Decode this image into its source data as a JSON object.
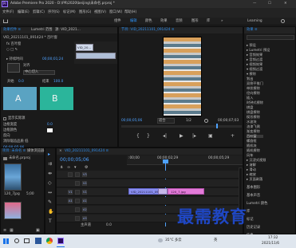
{
  "window": {
    "title": "Adobe Premiere Pro 2020 - D:\\PR\\2020\\beijing\\未命名.prproj *",
    "controls": [
      "—",
      "☐",
      "✕"
    ]
  },
  "menu": [
    "文件(F)",
    "编辑(E)",
    "剪辑(C)",
    "序列(S)",
    "标记(M)",
    "图形(G)",
    "视图(V)",
    "窗口(W)",
    "帮助(H)"
  ],
  "workspaces": [
    "组件",
    "编辑",
    "颜色",
    "效果",
    "音频",
    "图形",
    "库",
    "»"
  ],
  "workspace_right": "Learning",
  "effect_controls": {
    "tabs": [
      "效果控件 ≡",
      "Lumetri 范围",
      "源: VID_2021..."
    ],
    "header": "VID_20211101_091424 * 百叶窗",
    "clip_label": "VID_20...",
    "fx": "fx 百叶窗",
    "items": [
      "○ □ ✎",
      "▸ 过渡持续时间 00;00;01;24",
      "对齐  中心切入",
      "▸ 开始 0.0  结束 100.0",
      "A",
      "B",
      "显示实际源",
      "边框宽度",
      "边框颜色",
      "反向",
      "消除锯齿品质  低"
    ],
    "align_value": "中心切入",
    "start_label": "开始",
    "start_value": "0.0",
    "end_label": "结束",
    "end_value": "100.0",
    "duration_value": "00;00;01;24",
    "a_label": "A",
    "b_label": "B",
    "timecode": "00;00;05;06"
  },
  "program": {
    "tab": "节目: VID_20211101_091424 ≡",
    "timecode": "00;00;05;06",
    "fit": "适合",
    "fraction": "1/2",
    "duration": "00;00;07;03"
  },
  "effects": {
    "tab": "效果 ≡",
    "search_placeholder": "",
    "tree": [
      "▸ 预设",
      "▸ Lumetri 预设",
      "▸ 音频效果",
      "▸ 音频过渡",
      "▸ 视频效果",
      "▾ 视频过渡",
      "  ▾ 擦除",
      "     划出",
      "     双侧平推门",
      "     带状擦除",
      "     径向擦除",
      "     插入",
      "     时钟式擦除",
      "     棋盘",
      "     棋盘擦除",
      "     楔形擦除",
      "     水波块",
      "     油漆飞溅",
      "     渐变擦除",
      "     百叶窗",
      "     螺旋框",
      "     随机块",
      "     随机擦除",
      "     风车",
      "  ▸ 沉浸式视频",
      "  ▸ 溶解",
      "  ▸ 滑动",
      "  ▸ 缩放",
      "  ▸ 页面剥落"
    ],
    "panels": [
      "基本图形",
      "基本声音",
      "Lumetri 颜色",
      "库",
      "标记",
      "历史记录",
      "信息"
    ]
  },
  "project": {
    "tabs": [
      "项目: 未命名 ≡",
      "媒体浏览器"
    ],
    "name": "未命名.prproj",
    "thumb_label": "120_7jpg",
    "thumb_count": "5;00"
  },
  "timeline": {
    "tab": "VID_20211101_091424 ≡",
    "timecode": "00;00;05;06",
    "ruler": [
      ":00;00",
      "00;00;02;29",
      "00;00;05;29"
    ],
    "tracks_video": [
      "V3",
      "V2",
      "V1"
    ],
    "tracks_audio": [
      "A1",
      "A2",
      "A3"
    ],
    "clip1": "VID_20211101_0914...",
    "clip2": "120_7.jpg",
    "master": "主声道",
    "master_value": "0.0"
  },
  "taskbar": {
    "temp": "35°C 多云",
    "ime": "英",
    "time": "17:32",
    "date": "2021/11/6"
  },
  "watermark": "最需教育"
}
